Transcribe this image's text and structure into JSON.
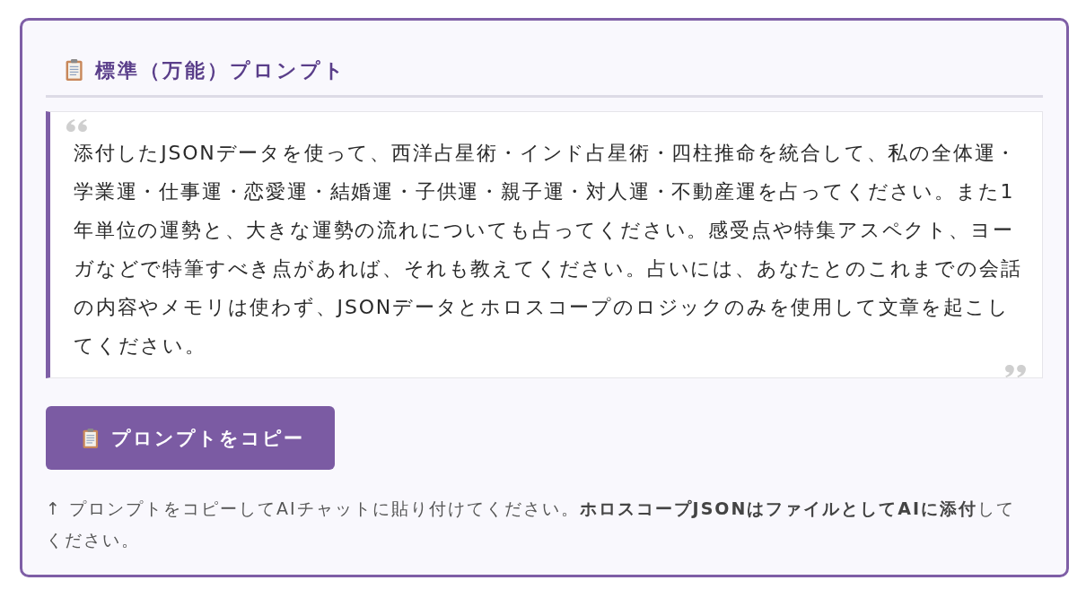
{
  "section": {
    "title": "標準（万能）プロンプト"
  },
  "prompt": {
    "text": "添付したJSONデータを使って、西洋占星術・インド占星術・四柱推命を統合して、私の全体運・学業運・仕事運・恋愛運・結婚運・子供運・親子運・対人運・不動産運を占ってください。また1年単位の運勢と、大きな運勢の流れについても占ってください。感受点や特集アスペクト、ヨーガなどで特筆すべき点があれば、それも教えてください。占いには、あなたとのこれまでの会話の内容やメモリは使わず、JSONデータとホロスコープのロジックのみを使用して文章を起こしてください。"
  },
  "copy_button": {
    "label": "プロンプトをコピー"
  },
  "note": "↑ プロンプトをコピーしてAIチャットに貼り付けてください。**ホロスコープJSONはファイルとしてAIに添付**してください。"
}
